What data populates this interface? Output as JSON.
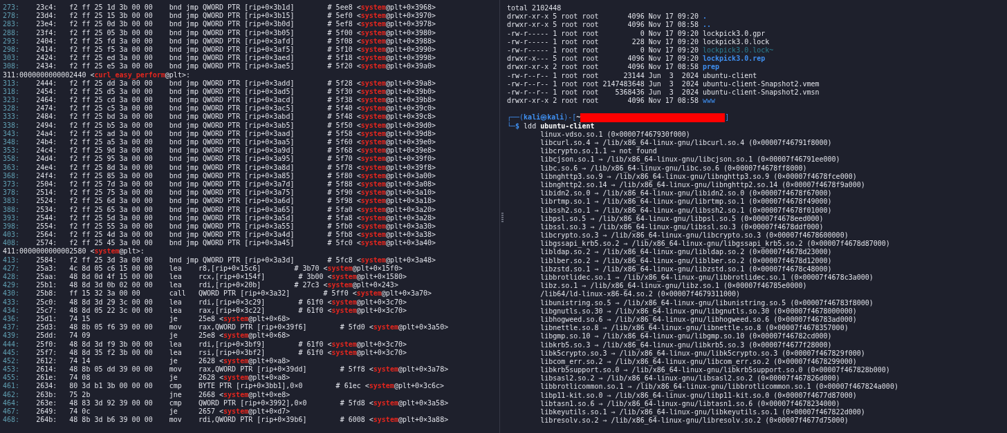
{
  "disassembly": {
    "rows": [
      {
        "kind": "instr",
        "line": "273:",
        "address": "23c4:",
        "bytes": "f2 ff 25 1d 3b 00 00",
        "mnemonic": "bnd jmp",
        "operands": "QWORD PTR [rip+0×3b1d]",
        "comment": "# 5ee8 <**system**@plt+0×3968>"
      },
      {
        "kind": "instr",
        "line": "278:",
        "address": "23d4:",
        "bytes": "f2 ff 25 15 3b 00 00",
        "mnemonic": "bnd jmp",
        "operands": "QWORD PTR [rip+0×3b15]",
        "comment": "# 5ef0 <**system**@plt+0×3970>"
      },
      {
        "kind": "instr",
        "line": "283:",
        "address": "23e4:",
        "bytes": "f2 ff 25 0d 3b 00 00",
        "mnemonic": "bnd jmp",
        "operands": "QWORD PTR [rip+0×3b0d]",
        "comment": "# 5ef8 <**system**@plt+0×3978>"
      },
      {
        "kind": "instr",
        "line": "288:",
        "address": "23f4:",
        "bytes": "f2 ff 25 05 3b 00 00",
        "mnemonic": "bnd jmp",
        "operands": "QWORD PTR [rip+0×3b05]",
        "comment": "# 5f00 <**system**@plt+0×3980>"
      },
      {
        "kind": "instr",
        "line": "293:",
        "address": "2404:",
        "bytes": "f2 ff 25 fd 3a 00 00",
        "mnemonic": "bnd jmp",
        "operands": "QWORD PTR [rip+0×3afd]",
        "comment": "# 5f08 <**system**@plt+0×3988>"
      },
      {
        "kind": "instr",
        "line": "298:",
        "address": "2414:",
        "bytes": "f2 ff 25 f5 3a 00 00",
        "mnemonic": "bnd jmp",
        "operands": "QWORD PTR [rip+0×3af5]",
        "comment": "# 5f10 <**system**@plt+0×3990>"
      },
      {
        "kind": "instr",
        "line": "303:",
        "address": "2424:",
        "bytes": "f2 ff 25 ed 3a 00 00",
        "mnemonic": "bnd jmp",
        "operands": "QWORD PTR [rip+0×3aed]",
        "comment": "# 5f18 <**system**@plt+0×3998>"
      },
      {
        "kind": "instr",
        "line": "308:",
        "address": "2434:",
        "bytes": "f2 ff 25 e5 3a 00 00",
        "mnemonic": "bnd jmp",
        "operands": "QWORD PTR [rip+0×3ae5]",
        "comment": "# 5f20 <**system**@plt+0×39a0>"
      },
      {
        "kind": "label",
        "line": "311:",
        "text": "0000000000002440 <**curl_easy_perform**@plt>:"
      },
      {
        "kind": "instr",
        "line": "313:",
        "address": "2444:",
        "bytes": "f2 ff 25 dd 3a 00 00",
        "mnemonic": "bnd jmp",
        "operands": "QWORD PTR [rip+0×3add]",
        "comment": "# 5f28 <**system**@plt+0×39a8>"
      },
      {
        "kind": "instr",
        "line": "318:",
        "address": "2454:",
        "bytes": "f2 ff 25 d5 3a 00 00",
        "mnemonic": "bnd jmp",
        "operands": "QWORD PTR [rip+0×3ad5]",
        "comment": "# 5f30 <**system**@plt+0×39b0>"
      },
      {
        "kind": "instr",
        "line": "323:",
        "address": "2464:",
        "bytes": "f2 ff 25 cd 3a 00 00",
        "mnemonic": "bnd jmp",
        "operands": "QWORD PTR [rip+0×3acd]",
        "comment": "# 5f38 <**system**@plt+0×39b8>"
      },
      {
        "kind": "instr",
        "line": "328:",
        "address": "2474:",
        "bytes": "f2 ff 25 c5 3a 00 00",
        "mnemonic": "bnd jmp",
        "operands": "QWORD PTR [rip+0×3ac5]",
        "comment": "# 5f40 <**system**@plt+0×39c0>"
      },
      {
        "kind": "instr",
        "line": "333:",
        "address": "2484:",
        "bytes": "f2 ff 25 bd 3a 00 00",
        "mnemonic": "bnd jmp",
        "operands": "QWORD PTR [rip+0×3abd]",
        "comment": "# 5f48 <**system**@plt+0×39c8>"
      },
      {
        "kind": "instr",
        "line": "338:",
        "address": "2494:",
        "bytes": "f2 ff 25 b5 3a 00 00",
        "mnemonic": "bnd jmp",
        "operands": "QWORD PTR [rip+0×3ab5]",
        "comment": "# 5f50 <**system**@plt+0×39d0>"
      },
      {
        "kind": "instr",
        "line": "343:",
        "address": "24a4:",
        "bytes": "f2 ff 25 ad 3a 00 00",
        "mnemonic": "bnd jmp",
        "operands": "QWORD PTR [rip+0×3aad]",
        "comment": "# 5f58 <**system**@plt+0×39d8>"
      },
      {
        "kind": "instr",
        "line": "348:",
        "address": "24b4:",
        "bytes": "f2 ff 25 a5 3a 00 00",
        "mnemonic": "bnd jmp",
        "operands": "QWORD PTR [rip+0×3aa5]",
        "comment": "# 5f60 <**system**@plt+0×39e0>"
      },
      {
        "kind": "instr",
        "line": "353:",
        "address": "24c4:",
        "bytes": "f2 ff 25 9d 3a 00 00",
        "mnemonic": "bnd jmp",
        "operands": "QWORD PTR [rip+0×3a9d]",
        "comment": "# 5f68 <**system**@plt+0×39e8>"
      },
      {
        "kind": "instr",
        "line": "358:",
        "address": "24d4:",
        "bytes": "f2 ff 25 95 3a 00 00",
        "mnemonic": "bnd jmp",
        "operands": "QWORD PTR [rip+0×3a95]",
        "comment": "# 5f70 <**system**@plt+0×39f0>"
      },
      {
        "kind": "instr",
        "line": "363:",
        "address": "24e4:",
        "bytes": "f2 ff 25 8d 3a 00 00",
        "mnemonic": "bnd jmp",
        "operands": "QWORD PTR [rip+0×3a8d]",
        "comment": "# 5f78 <**system**@plt+0×39f8>"
      },
      {
        "kind": "instr",
        "line": "368:",
        "address": "24f4:",
        "bytes": "f2 ff 25 85 3a 00 00",
        "mnemonic": "bnd jmp",
        "operands": "QWORD PTR [rip+0×3a85]",
        "comment": "# 5f80 <**system**@plt+0×3a00>"
      },
      {
        "kind": "instr",
        "line": "373:",
        "address": "2504:",
        "bytes": "f2 ff 25 7d 3a 00 00",
        "mnemonic": "bnd jmp",
        "operands": "QWORD PTR [rip+0×3a7d]",
        "comment": "# 5f88 <**system**@plt+0×3a08>"
      },
      {
        "kind": "instr",
        "line": "378:",
        "address": "2514:",
        "bytes": "f2 ff 25 75 3a 00 00",
        "mnemonic": "bnd jmp",
        "operands": "QWORD PTR [rip+0×3a75]",
        "comment": "# 5f90 <**system**@plt+0×3a10>"
      },
      {
        "kind": "instr",
        "line": "383:",
        "address": "2524:",
        "bytes": "f2 ff 25 6d 3a 00 00",
        "mnemonic": "bnd jmp",
        "operands": "QWORD PTR [rip+0×3a6d]",
        "comment": "# 5f98 <**system**@plt+0×3a18>"
      },
      {
        "kind": "instr",
        "line": "388:",
        "address": "2534:",
        "bytes": "f2 ff 25 65 3a 00 00",
        "mnemonic": "bnd jmp",
        "operands": "QWORD PTR [rip+0×3a65]",
        "comment": "# 5fa0 <**system**@plt+0×3a20>"
      },
      {
        "kind": "instr",
        "line": "393:",
        "address": "2544:",
        "bytes": "f2 ff 25 5d 3a 00 00",
        "mnemonic": "bnd jmp",
        "operands": "QWORD PTR [rip+0×3a5d]",
        "comment": "# 5fa8 <**system**@plt+0×3a28>"
      },
      {
        "kind": "instr",
        "line": "398:",
        "address": "2554:",
        "bytes": "f2 ff 25 55 3a 00 00",
        "mnemonic": "bnd jmp",
        "operands": "QWORD PTR [rip+0×3a55]",
        "comment": "# 5fb0 <**system**@plt+0×3a30>"
      },
      {
        "kind": "instr",
        "line": "403:",
        "address": "2564:",
        "bytes": "f2 ff 25 4d 3a 00 00",
        "mnemonic": "bnd jmp",
        "operands": "QWORD PTR [rip+0×3a4d]",
        "comment": "# 5fb8 <**system**@plt+0×3a38>"
      },
      {
        "kind": "instr",
        "line": "408:",
        "address": "2574:",
        "bytes": "f2 ff 25 45 3a 00 00",
        "mnemonic": "bnd jmp",
        "operands": "QWORD PTR [rip+0×3a45]",
        "comment": "# 5fc0 <**system**@plt+0×3a40>"
      },
      {
        "kind": "label",
        "line": "411:",
        "text": "0000000000002580 <**system**@plt>:"
      },
      {
        "kind": "instr",
        "line": "413:",
        "address": "2584:",
        "bytes": "f2 ff 25 3d 3a 00 00",
        "mnemonic": "bnd jmp",
        "operands": "QWORD PTR [rip+0×3a3d]",
        "comment": "# 5fc8 <**system**@plt+0×3a48>"
      },
      {
        "kind": "instr",
        "line": "427:",
        "address": "25a3:",
        "bytes": "4c 8d 05 c6 15 00 00",
        "mnemonic": "lea",
        "operands": "r8,[rip+0×15c6]",
        "comment": "# 3b70 <**system**@plt+0×15f0>"
      },
      {
        "kind": "instr",
        "line": "428:",
        "address": "25aa:",
        "bytes": "48 8d 0d 4f 15 00 00",
        "mnemonic": "lea",
        "operands": "rcx,[rip+0×154f]",
        "comment": "# 3b00 <**system**@plt+0×1580>"
      },
      {
        "kind": "instr",
        "line": "429:",
        "address": "25b1:",
        "bytes": "48 8d 3d 0b 02 00 00",
        "mnemonic": "lea",
        "operands": "rdi,[rip+0×20b]",
        "comment": "# 27c3 <**system**@plt+0×243>"
      },
      {
        "kind": "instr",
        "line": "430:",
        "address": "25b8:",
        "bytes": "ff 15 32 3a 00 00",
        "mnemonic": "call",
        "operands": "QWORD PTR [rip+0×3a32]",
        "comment": "# 5ff0 <**system**@plt+0×3a70>"
      },
      {
        "kind": "instr",
        "line": "433:",
        "address": "25c0:",
        "bytes": "48 8d 3d 29 3c 00 00",
        "mnemonic": "lea",
        "operands": "rdi,[rip+0×3c29]",
        "comment": "# 61f0 <**system**@plt+0×3c70>"
      },
      {
        "kind": "instr",
        "line": "434:",
        "address": "25c7:",
        "bytes": "48 8d 05 22 3c 00 00",
        "mnemonic": "lea",
        "operands": "rax,[rip+0×3c22]",
        "comment": "# 61f0 <**system**@plt+0×3c70>"
      },
      {
        "kind": "instr",
        "line": "436:",
        "address": "25d1:",
        "bytes": "74 15",
        "mnemonic": "je",
        "operands": "25e8 <**system**@plt+0×68>"
      },
      {
        "kind": "instr",
        "line": "437:",
        "address": "25d3:",
        "bytes": "48 8b 05 f6 39 00 00",
        "mnemonic": "mov",
        "operands": "rax,QWORD PTR [rip+0×39f6]",
        "comment": "# 5fd0 <**system**@plt+0×3a50>"
      },
      {
        "kind": "instr",
        "line": "439:",
        "address": "25dd:",
        "bytes": "74 09",
        "mnemonic": "je",
        "operands": "25e8 <**system**@plt+0×68>"
      },
      {
        "kind": "instr",
        "line": "444:",
        "address": "25f0:",
        "bytes": "48 8d 3d f9 3b 00 00",
        "mnemonic": "lea",
        "operands": "rdi,[rip+0×3bf9]",
        "comment": "# 61f0 <**system**@plt+0×3c70>"
      },
      {
        "kind": "instr",
        "line": "445:",
        "address": "25f7:",
        "bytes": "48 8d 35 f2 3b 00 00",
        "mnemonic": "lea",
        "operands": "rsi,[rip+0×3bf2]",
        "comment": "# 61f0 <**system**@plt+0×3c70>"
      },
      {
        "kind": "instr",
        "line": "452:",
        "address": "2612:",
        "bytes": "74 14",
        "mnemonic": "je",
        "operands": "2628 <**system**@plt+0×a8>"
      },
      {
        "kind": "instr",
        "line": "453:",
        "address": "2614:",
        "bytes": "48 8b 05 dd 39 00 00",
        "mnemonic": "mov",
        "operands": "rax,QWORD PTR [rip+0×39dd]",
        "comment": "# 5ff8 <**system**@plt+0×3a78>"
      },
      {
        "kind": "instr",
        "line": "455:",
        "address": "261e:",
        "bytes": "74 08",
        "mnemonic": "je",
        "operands": "2628 <**system**@plt+0×a8>"
      },
      {
        "kind": "instr",
        "line": "461:",
        "address": "2634:",
        "bytes": "80 3d b1 3b 00 00 00",
        "mnemonic": "cmp",
        "operands": "BYTE PTR [rip+0×3bb1],0×0",
        "comment": "# 61ec <**system**@plt+0×3c6c>"
      },
      {
        "kind": "instr",
        "line": "462:",
        "address": "263b:",
        "bytes": "75 2b",
        "mnemonic": "jne",
        "operands": "2668 <**system**@plt+0×e8>"
      },
      {
        "kind": "instr",
        "line": "464:",
        "address": "263e:",
        "bytes": "48 83 3d 92 39 00 00",
        "mnemonic": "cmp",
        "operands": "QWORD PTR [rip+0×3992],0×0",
        "comment": "# 5fd8 <**system**@plt+0×3a58>"
      },
      {
        "kind": "instr",
        "line": "467:",
        "address": "2649:",
        "bytes": "74 0c",
        "mnemonic": "je",
        "operands": "2657 <**system**@plt+0×d7>"
      },
      {
        "kind": "instr",
        "line": "468:",
        "address": "264b:",
        "bytes": "48 8b 3d b6 39 00 00",
        "mnemonic": "mov",
        "operands": "rdi,QWORD PTR [rip+0×39b6]",
        "comment": "# 6008 <**system**@plt+0×3a88>"
      }
    ]
  },
  "terminal": {
    "total": "total 2102448",
    "entries": [
      {
        "perms": "drwxr-xr-x",
        "links": "5",
        "owner": "root",
        "group": "root",
        "size": "4096",
        "date": "Nov 17 09:20",
        "name": ".",
        "kind": "dir"
      },
      {
        "perms": "drwxr-xr-x",
        "links": "5",
        "owner": "root",
        "group": "root",
        "size": "4096",
        "date": "Nov 17 08:58",
        "name": "..",
        "kind": "dir"
      },
      {
        "perms": "-rw-r-----",
        "links": "1",
        "owner": "root",
        "group": "root",
        "size": "0",
        "date": "Nov 17 09:20",
        "name": "lockpick3.0.gpr",
        "kind": "file"
      },
      {
        "perms": "-rw-r-----",
        "links": "1",
        "owner": "root",
        "group": "root",
        "size": "228",
        "date": "Nov 17 09:20",
        "name": "lockpick3.0.lock",
        "kind": "file"
      },
      {
        "perms": "-rw-r-----",
        "links": "1",
        "owner": "root",
        "group": "root",
        "size": "0",
        "date": "Nov 17 09:20",
        "name": "lockpick3.0.lock~",
        "kind": "backup"
      },
      {
        "perms": "drwxr-x---",
        "links": "5",
        "owner": "root",
        "group": "root",
        "size": "4096",
        "date": "Nov 17 09:20",
        "name": "lockpick3.0.rep",
        "kind": "dir"
      },
      {
        "perms": "drwxr-xr-x",
        "links": "2",
        "owner": "root",
        "group": "root",
        "size": "4096",
        "date": "Nov 17 08:58",
        "name": "prep",
        "kind": "dir"
      },
      {
        "perms": "-rw-r--r--",
        "links": "1",
        "owner": "root",
        "group": "root",
        "size": "23144",
        "date": "Jun  3  2024",
        "name": "ubuntu-client",
        "kind": "file"
      },
      {
        "perms": "-rw-r--r--",
        "links": "1",
        "owner": "root",
        "group": "root",
        "size": "2147483648",
        "date": "Jun  3  2024",
        "name": "ubuntu-client-Snapshot2.vmem",
        "kind": "file"
      },
      {
        "perms": "-rw-r--r--",
        "links": "1",
        "owner": "root",
        "group": "root",
        "size": "5368436",
        "date": "Jun  3  2024",
        "name": "ubuntu-client-Snapshot2.vmsn",
        "kind": "file"
      },
      {
        "perms": "drwxr-xr-x",
        "links": "2",
        "owner": "root",
        "group": "root",
        "size": "4096",
        "date": "Nov 17 08:58",
        "name": "www",
        "kind": "other"
      }
    ],
    "prompt": {
      "top_corner": "┌──(",
      "user": "kali㉿kali",
      "separator": ")-[",
      "path": "~",
      "redacted": true,
      "close": "]",
      "bottom_corner": "└─",
      "symbol": "$",
      "command": "ldd",
      "argument": "ubuntu-client"
    },
    "output": [
      "linux-vdso.so.1 (0×00007f467930f000)",
      "libcurl.so.4 ⇒ /lib/x86_64-linux-gnu/libcurl.so.4 (0×00007f46791f8000)",
      "libcrypto.so.1.1 ⇒ not found",
      "libcjson.so.1 ⇒ /lib/x86_64-linux-gnu/libcjson.so.1 (0×00007f46791ee000)",
      "libc.so.6 ⇒ /lib/x86_64-linux-gnu/libc.so.6 (0×00007f4678ff8000)",
      "libnghttp3.so.9 ⇒ /lib/x86_64-linux-gnu/libnghttp3.so.9 (0×00007f4678fce000)",
      "libnghttp2.so.14 ⇒ /lib/x86_64-linux-gnu/libnghttp2.so.14 (0×00007f4678f9a000)",
      "libidn2.so.0 ⇒ /lib/x86_64-linux-gnu/libidn2.so.0 (0×00007f4678f67000)",
      "librtmp.so.1 ⇒ /lib/x86_64-linux-gnu/librtmp.so.1 (0×00007f4678f49000)",
      "libssh2.so.1 ⇒ /lib/x86_64-linux-gnu/libssh2.so.1 (0×00007f4678f01000)",
      "libpsl.so.5 ⇒ /lib/x86_64-linux-gnu/libpsl.so.5 (0×00007f4678eed000)",
      "libssl.so.3 ⇒ /lib/x86_64-linux-gnu/libssl.so.3 (0×00007f4678ddf000)",
      "libcrypto.so.3 ⇒ /lib/x86_64-linux-gnu/libcrypto.so.3 (0×00007f4678600000)",
      "libgssapi_krb5.so.2 ⇒ /lib/x86_64-linux-gnu/libgssapi_krb5.so.2 (0×00007f4678d87000)",
      "libldap.so.2 ⇒ /lib/x86_64-linux-gnu/libldap.so.2 (0×00007f4678d23000)",
      "liblber.so.2 ⇒ /lib/x86_64-linux-gnu/liblber.so.2 (0×00007f4678d12000)",
      "libzstd.so.1 ⇒ /lib/x86_64-linux-gnu/libzstd.so.1 (0×00007f4678c48000)",
      "libbrotlidec.so.1 ⇒ /lib/x86_64-linux-gnu/libbrotlidec.so.1 (0×00007f4678c3a000)",
      "libz.so.1 ⇒ /lib/x86_64-linux-gnu/libz.so.1 (0×00007f46785e0000)",
      "/lib64/ld-linux-x86-64.so.2 (0×00007f4679311000)",
      "libunistring.so.5 ⇒ /lib/x86_64-linux-gnu/libunistring.so.5 (0×00007f46783f8000)",
      "libgnutls.so.30 ⇒ /lib/x86_64-linux-gnu/libgnutls.so.30 (0×00007f4678000000)",
      "libhogweed.so.6 ⇒ /lib/x86_64-linux-gnu/libhogweed.so.6 (0×00007f46783ad000)",
      "libnettle.so.8 ⇒ /lib/x86_64-linux-gnu/libnettle.so.8 (0×00007f4678357000)",
      "libgmp.so.10 ⇒ /lib/x86_64-linux-gnu/libgmp.so.10 (0×00007f46782cd000)",
      "libkrb5.so.3 ⇒ /lib/x86_64-linux-gnu/libkrb5.so.3 (0×00007f4677f28000)",
      "libk5crypto.so.3 ⇒ /lib/x86_64-linux-gnu/libk5crypto.so.3 (0×00007f467829f000)",
      "libcom_err.so.2 ⇒ /lib/x86_64-linux-gnu/libcom_err.so.2 (0×00007f4678299000)",
      "libkrb5support.so.0 ⇒ /lib/x86_64-linux-gnu/libkrb5support.so.0 (0×00007f467828b000)",
      "libsasl2.so.2 ⇒ /lib/x86_64-linux-gnu/libsasl2.so.2 (0×00007f467826d000)",
      "libbrotlicommon.so.1 ⇒ /lib/x86_64-linux-gnu/libbrotlicommon.so.1 (0×00007f467824a000)",
      "libp11-kit.so.0 ⇒ /lib/x86_64-linux-gnu/libp11-kit.so.0 (0×00007f4677d87000)",
      "libtasn1.so.6 ⇒ /lib/x86_64-linux-gnu/libtasn1.so.6 (0×00007f4678234000)",
      "libkeyutils.so.1 ⇒ /lib/x86_64-linux-gnu/libkeyutils.so.1 (0×00007f467822d000)",
      "libresolv.so.2 ⇒ /lib/x86_64-linux-gnu/libresolv.so.2 (0×00007f4677d75000)"
    ]
  }
}
